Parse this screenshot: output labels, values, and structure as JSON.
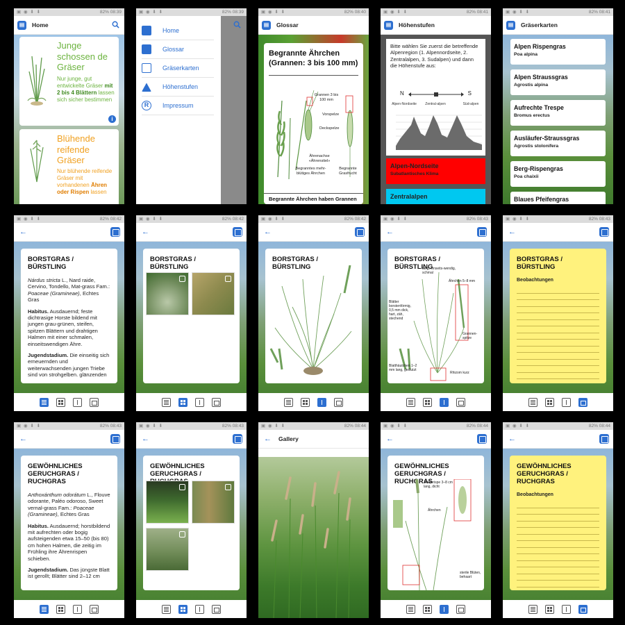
{
  "status": {
    "battery": "82%",
    "times": [
      "08:39",
      "08:39",
      "08:40",
      "08:41",
      "08:41",
      "08:42",
      "08:42",
      "08:42",
      "08:43",
      "08:43",
      "08:43",
      "08:43",
      "08:44",
      "08:44",
      "08:44"
    ]
  },
  "home": {
    "title": "Home",
    "card1": {
      "heading": "Junge schossen de Gräser",
      "text_a": "Nur junge, gut entwickelte Gräser ",
      "text_b": "mit 2 bis 4 Blättern",
      "text_c": " lassen sich sicher bestimmen"
    },
    "card2": {
      "heading": "Blühende reifende Gräser",
      "text_a": "Nur blühende reifende Gräser mit vorhandenen ",
      "text_b": "Ähren oder Rispen",
      "text_c": " lassen"
    }
  },
  "menu": {
    "items": [
      "Home",
      "Glossar",
      "Gräserkarten",
      "Höhenstufen",
      "Impressum"
    ]
  },
  "glossar": {
    "title": "Glossar",
    "heading": "Begrannte Ährchen (Grannen: 3 bis 100 mm)",
    "labels": [
      "Grannen 3 bis 100 mm",
      "Vorspelze",
      "Deckspelze",
      "Ährenachse «Ährenstiel»",
      "Begranntes mehr-blütiges Ährchen",
      "Begrannte Grasfrucht"
    ],
    "footer": "Begrannte Ährchen haben Grannen"
  },
  "hoehen": {
    "title": "Höhenstufen",
    "text": "Bitte wählen Sie zuerst die betreffende Alpenregion (1. Alpennordseite, 2. Zentralalpen, 3. Sudalpen) und dann die Höhenstufe aus:",
    "n": "N",
    "s": "S",
    "regions": [
      "Alpen-Nordseite",
      "Zentral-alpen",
      "Süd-alpen"
    ],
    "btn1": {
      "title": "Alpen-Nordseite",
      "sub": "Subatlantisches Klima"
    },
    "btn2": {
      "title": "Zentralalpen"
    },
    "colors": {
      "red": "#ff0000",
      "cyan": "#00c8f0"
    }
  },
  "karten": {
    "title": "Gräserkarten",
    "items": [
      {
        "name": "Alpen Rispengras",
        "latin": "Poa alpina"
      },
      {
        "name": "Alpen Straussgras",
        "latin": "Agrostis alpina"
      },
      {
        "name": "Aufrechte Trespe",
        "latin": "Bromus erectus"
      },
      {
        "name": "Ausläufer-Straussgras",
        "latin": "Agrostis stolonifera"
      },
      {
        "name": "Berg-Rispengras",
        "latin": "Poa chaixii"
      },
      {
        "name": "Blaues Pfeifengras",
        "latin": ""
      }
    ]
  },
  "borstgras": {
    "title": "BORSTGRAS / BÜRSTLING",
    "latin": "Nárdus stricta",
    "syn": " L., Nard raide, Cervino, Tondello, Mat-grass",
    "fam_label": "Fam.: ",
    "fam": "Poaceae (Gramineae)",
    "fam_end": ", Echtes Gras",
    "habitus_label": "Habitus.",
    "habitus": " Ausdauernd; feste dichtrasige Horste bildend mit jungen grau-grünen, steifen, spitzen Blättern und drahtigen Halmen mit einer schmalen, einseitswendigen Ähre.",
    "jugend_label": "Jugendstadium.",
    "jugend": " Die einseitig sich erneuernden und weiterwachsenden jungen Triebe sind von strohgelben. glänzenden",
    "diagram_labels": [
      "lang, einseits-wendig, schmal",
      "Ährchen 5–8 mm",
      "Blätter borstenförmig, 0,5 mm dick, hart, zäh, stechend",
      "Grannen-spitze",
      "Blatthäutchen 1–2 mm lang, gestutzt",
      "Rhizom kurz"
    ],
    "notes_label": "Beobachtungen"
  },
  "ruchgras": {
    "title": "GEWÖHNLICHES GERUCHGRAS / RUCHGRAS",
    "latin": "Anthoxánthum odorátum",
    "syn": " L., Flouve odorante, Paléo odoroso, Sweet vernal-grass",
    "fam_label": "Fam.: ",
    "fam": "Poaceae (Gramineae)",
    "fam_end": ", Echtes Gras",
    "habitus_label": "Habitus.",
    "habitus": " Ausdauernd; horstbildend mit aufrechten oder bogig aufsteigenden etwa 15–50 (bis 80) cm hohen Halmen, die zeitig im Frühling ihre Ährenrispen schieben.",
    "jugend_label": "Jugendstadium.",
    "jugend": " Das jüngste Blatt ist gerollt; Blätter sind 2–12 cm",
    "diagram_labels": [
      "Ährenrispe 3–8 cm lang, dicht",
      "Ährchen",
      "sterile Blüten, behaart"
    ],
    "notes_label": "Beobachtungen"
  },
  "gallery": {
    "title": "Gallery"
  }
}
